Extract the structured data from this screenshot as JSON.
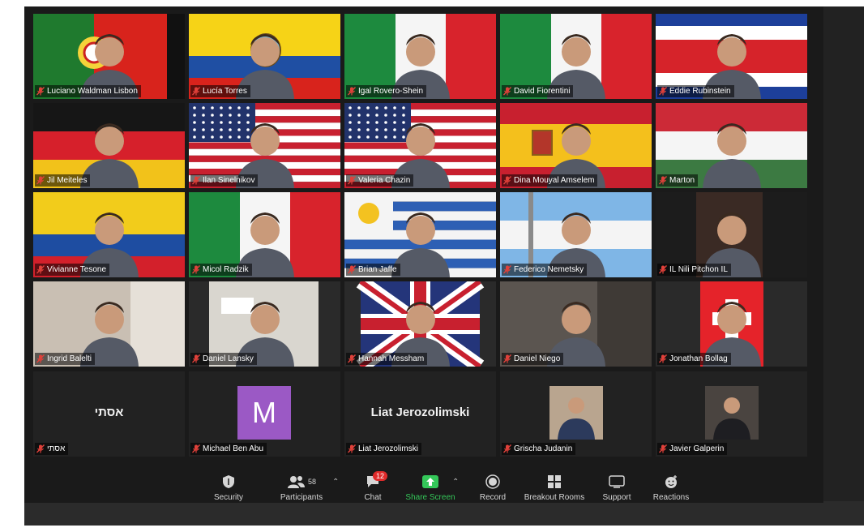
{
  "participants": [
    {
      "name": "Luciano Waldman Lisbon",
      "flag": "portugal"
    },
    {
      "name": "Lucía Torres",
      "flag": "ecuador"
    },
    {
      "name": "Igal Rovero-Shein",
      "flag": "italy"
    },
    {
      "name": "David Fiorentini",
      "flag": "italy"
    },
    {
      "name": "Eddie Rubinstein",
      "flag": "costa-rica"
    },
    {
      "name": "Jil Meiteles",
      "flag": "germany"
    },
    {
      "name": "Ilan Sinelnikov",
      "flag": "usa"
    },
    {
      "name": "Valeria Chazin",
      "flag": "usa"
    },
    {
      "name": "Dina Mouyal Amselem",
      "flag": "spain"
    },
    {
      "name": "Marton",
      "flag": "hungary"
    },
    {
      "name": "Vivianne Tesone",
      "flag": "colombia"
    },
    {
      "name": "Micol Radzik",
      "flag": "italy"
    },
    {
      "name": "Brian Jaffe",
      "flag": "uruguay"
    },
    {
      "name": "Federico Nemetsky",
      "flag": "argentina"
    },
    {
      "name": "IL Nili Pitchon IL",
      "flag": "dark"
    },
    {
      "name": "Ingrid Balelti",
      "flag": "room"
    },
    {
      "name": "Daniel Lansky",
      "flag": "room-light"
    },
    {
      "name": "Hannah Messham",
      "flag": "uk"
    },
    {
      "name": "Daniel Niego",
      "flag": "room-dim"
    },
    {
      "name": "Jonathan Bollag",
      "flag": "switzerland"
    },
    {
      "name": "אסתי",
      "flag": "none",
      "center_text": "אסתי"
    },
    {
      "name": "Michael Ben Abu",
      "flag": "none",
      "avatar_letter": "M"
    },
    {
      "name": "Liat Jerozolimski",
      "flag": "none",
      "center_text": "Liat Jerozolimski"
    },
    {
      "name": "Grischa Judanin",
      "flag": "none",
      "photo": "couple-photo"
    },
    {
      "name": "Javier Galperin",
      "flag": "none",
      "photo": "suit-photo"
    }
  ],
  "toolbar": {
    "security": "Security",
    "participants": "Participants",
    "participants_count": "58",
    "chat": "Chat",
    "chat_badge": "12",
    "share_screen": "Share Screen",
    "record": "Record",
    "breakout_rooms": "Breakout Rooms",
    "support": "Support",
    "reactions": "Reactions"
  },
  "colors": {
    "share_green": "#34c759",
    "badge_red": "#e02b2b",
    "muted_red": "#e0413a"
  }
}
